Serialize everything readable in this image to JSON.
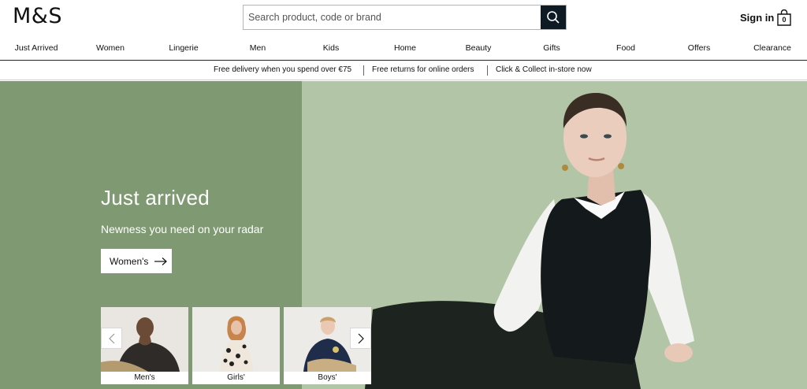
{
  "header": {
    "logo": "M&S",
    "search_placeholder": "Search product, code or brand",
    "signin_label": "Sign in",
    "bag_count": "0"
  },
  "nav": {
    "items": [
      {
        "label": "Just Arrived"
      },
      {
        "label": "Women"
      },
      {
        "label": "Lingerie"
      },
      {
        "label": "Men"
      },
      {
        "label": "Kids"
      },
      {
        "label": "Home"
      },
      {
        "label": "Beauty"
      },
      {
        "label": "Gifts"
      },
      {
        "label": "Food"
      },
      {
        "label": "Offers"
      },
      {
        "label": "Clearance"
      }
    ]
  },
  "promo": {
    "items": [
      {
        "label": "Free delivery when you spend over €75"
      },
      {
        "label": "Free returns for online orders"
      },
      {
        "label": "Click & Collect in-store now"
      }
    ]
  },
  "hero": {
    "title": "Just arrived",
    "subtitle": "Newness you need on your radar",
    "cta_label": "Women's",
    "thumbnails": [
      {
        "label": "Men's"
      },
      {
        "label": "Girls'"
      },
      {
        "label": "Boys'"
      }
    ]
  },
  "colors": {
    "hero_left": "#7f9a73",
    "hero_right": "#b3c5a7",
    "search_button": "#0f1b24"
  }
}
